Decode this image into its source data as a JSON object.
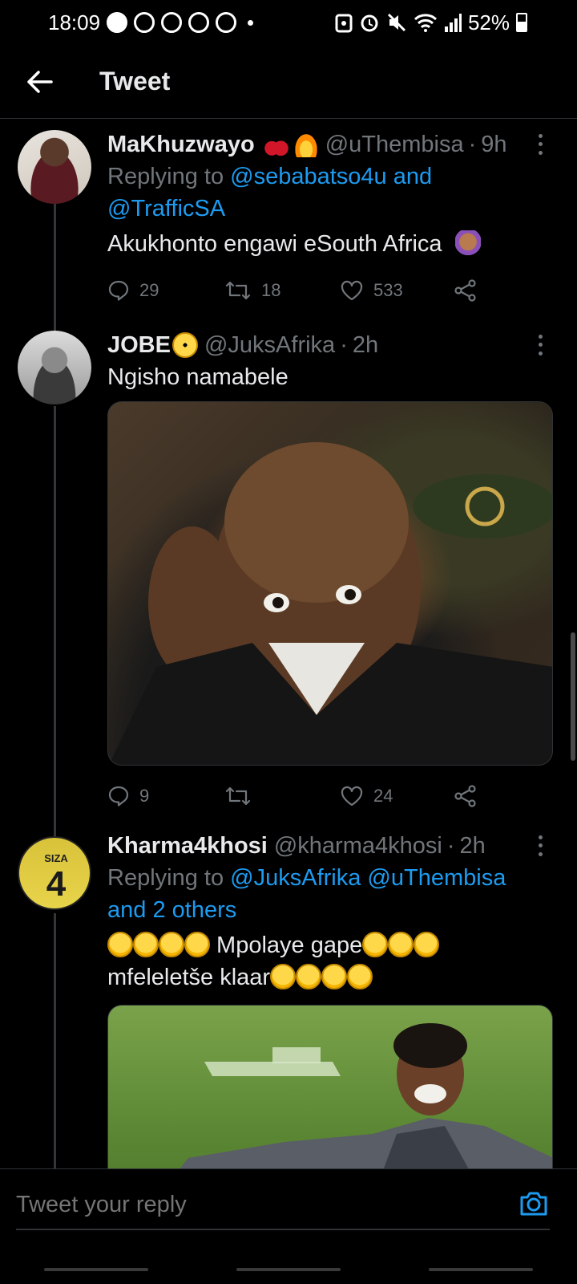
{
  "status_bar": {
    "time": "18:09",
    "battery": "52%"
  },
  "header": {
    "title": "Tweet"
  },
  "tweets": [
    {
      "name": "MaKhuzwayo",
      "handle": "@uThembisa",
      "time": "9h",
      "replying_label": "Replying to",
      "mentions": [
        "@sebabatso4u",
        "and",
        "@TrafficSA"
      ],
      "text": "Akukhonto engawi eSouth Africa",
      "replies": "29",
      "retweets": "18",
      "likes": "533"
    },
    {
      "name": "JOBE",
      "handle": "@JuksAfrika",
      "time": "2h",
      "text": "Ngisho namabele",
      "replies": "9",
      "retweets": "",
      "likes": "24"
    },
    {
      "name": "Kharma4khosi",
      "handle": "@kharma4khosi",
      "time": "2h",
      "replying_label": "Replying to",
      "mentions": [
        "@JuksAfrika",
        "@uThembisa",
        "and 2 others"
      ],
      "text_line1": " Mpolaye gape",
      "text_line2": "mfeleletše klaar",
      "jersey_text": "SIZA",
      "jersey_number": "4"
    }
  ],
  "reply_bar": {
    "placeholder": "Tweet your reply"
  },
  "icons": {
    "back": "arrow-left-icon",
    "more": "more-vertical-icon",
    "reply": "comment-icon",
    "retweet": "retweet-icon",
    "like": "heart-icon",
    "share": "share-icon",
    "camera": "camera-icon"
  },
  "colors": {
    "accent": "#1d9bf0",
    "muted": "#71767b",
    "text": "#e7e9ea",
    "background": "#000000"
  }
}
